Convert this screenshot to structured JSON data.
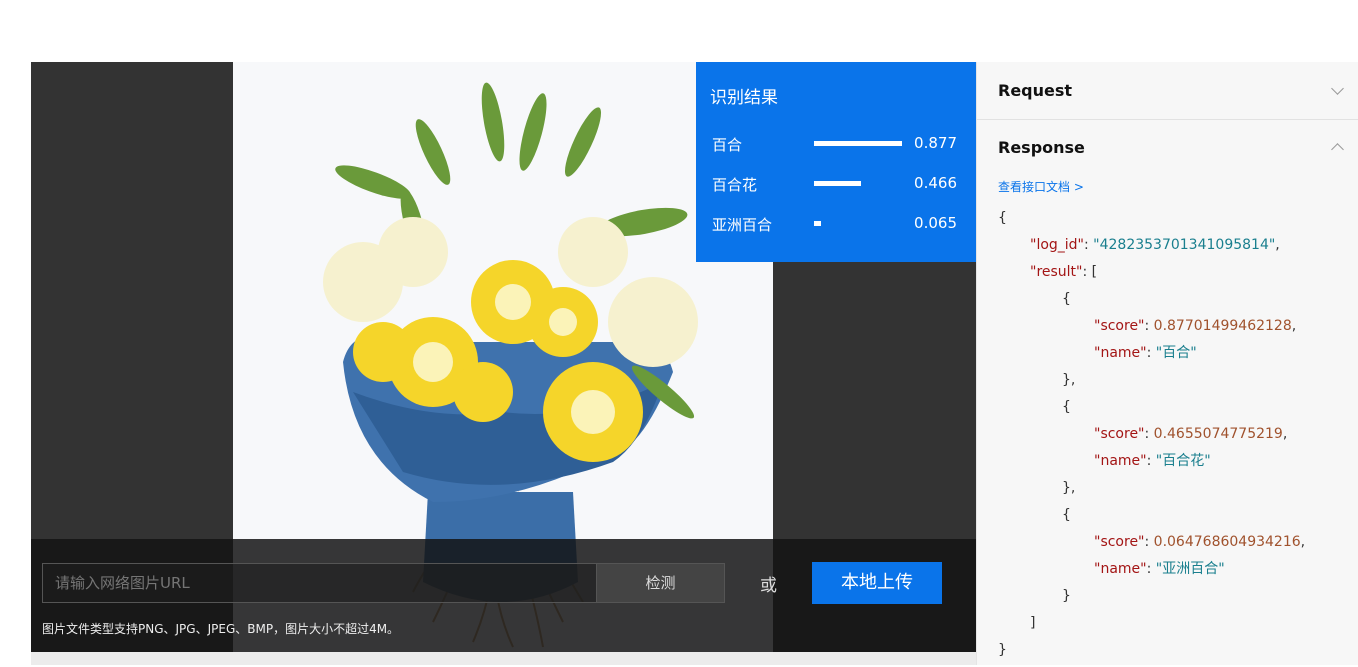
{
  "result": {
    "title": "识别结果",
    "items": [
      {
        "name": "百合",
        "score": "0.877",
        "fraction": 0.877
      },
      {
        "name": "百合花",
        "score": "0.466",
        "fraction": 0.466
      },
      {
        "name": "亚洲百合",
        "score": "0.065",
        "fraction": 0.065
      }
    ]
  },
  "controls": {
    "url_placeholder": "请输入网络图片URL",
    "detect_label": "检测",
    "or_label": "或",
    "upload_label": "本地上传",
    "hint": "图片文件类型支持PNG、JPG、JPEG、BMP，图片大小不超过4M。"
  },
  "sidebar": {
    "request_title": "Request",
    "response_title": "Response",
    "doc_link": "查看接口文档 >"
  },
  "response": {
    "open_brace": "{",
    "log_id_key": "\"log_id\"",
    "log_id_value": "\"4282353701341095814\"",
    "result_key": "\"result\"",
    "items": [
      {
        "score": "0.87701499462128",
        "name": "\"百合\""
      },
      {
        "score": "0.4655074775219",
        "name": "\"百合花\""
      },
      {
        "score": "0.064768604934216",
        "name": "\"亚洲百合\""
      }
    ],
    "score_key": "\"score\"",
    "name_key": "\"name\"",
    "close_bracket": "]",
    "close_brace": "}"
  },
  "colors": {
    "accent": "#0a74ea",
    "dark_bg": "#333333",
    "wrap_blue": "#3d6fa8",
    "lily_yellow": "#f5d52a"
  }
}
